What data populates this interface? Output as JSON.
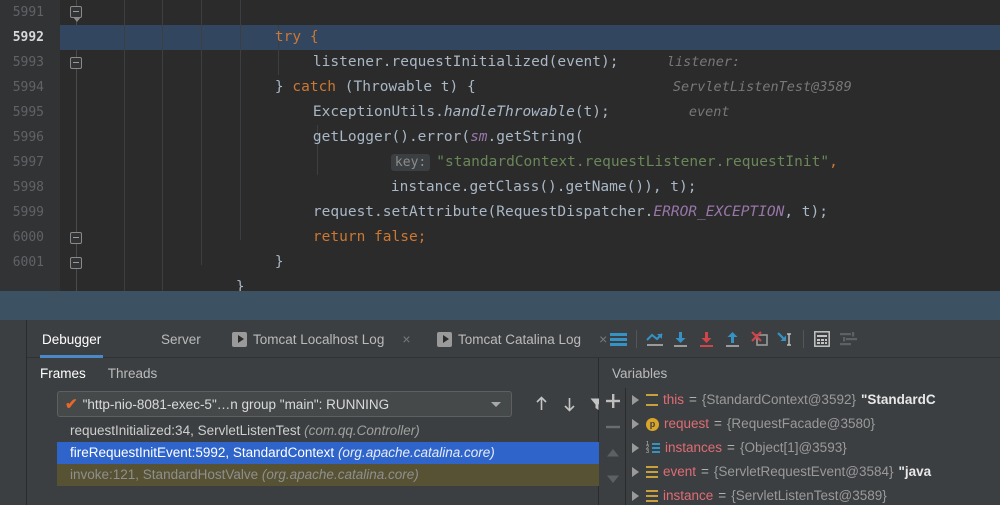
{
  "editor": {
    "first_line": 5991,
    "current_line": 5992,
    "lines": [
      {
        "num": "5991",
        "fold": "arrow"
      },
      {
        "num": "5992",
        "fold": ""
      },
      {
        "num": "5993",
        "fold": "plain"
      },
      {
        "num": "5994",
        "fold": ""
      },
      {
        "num": "5995",
        "fold": ""
      },
      {
        "num": "5996",
        "fold": ""
      },
      {
        "num": "5997",
        "fold": ""
      },
      {
        "num": "5998",
        "fold": ""
      },
      {
        "num": "5999",
        "fold": ""
      },
      {
        "num": "6000",
        "fold": "plain"
      },
      {
        "num": "6001",
        "fold": "plain"
      }
    ],
    "code": {
      "l5991": "try {",
      "l5992_code": "listener.requestInitialized(event);",
      "l5992_hint_listener": "listener:",
      "l5992_hint_listener_val": "ServletListenTest@3589",
      "l5992_hint_event": "event",
      "l5993_a": "} ",
      "l5993_b": "catch ",
      "l5993_c": "(Throwable t) {",
      "l5994_a": "ExceptionUtils.",
      "l5994_b": "handleThrowable",
      "l5994_c": "(t);",
      "l5995_a": "getLogger().error(",
      "l5995_b": "sm",
      "l5995_c": ".getString(",
      "l5996_key": "key:",
      "l5996_str": "\"standardContext.requestListener.requestInit\"",
      "l5996_comma": ",",
      "l5997": "instance.getClass().getName()), t);",
      "l5998_a": "request.setAttribute(RequestDispatcher.",
      "l5998_b": "ERROR_EXCEPTION",
      "l5998_c": ", t);",
      "l5999_a": "return ",
      "l5999_b": "false;",
      "l6000": "}",
      "l6001": "}"
    },
    "colors": {
      "background": "#2b2b2b",
      "gutter": "#313335",
      "selected_line": "#32465f",
      "keyword": "#cc7832",
      "string": "#6a8759",
      "field": "#9876aa",
      "text": "#a9b7c6",
      "hint": "#787878"
    }
  },
  "toolwindow": {
    "tabs": [
      {
        "label": "Debugger",
        "active": true,
        "icon": "",
        "close": false
      },
      {
        "label": "Server",
        "active": false,
        "icon": "",
        "close": false
      },
      {
        "label": "Tomcat Localhost Log",
        "active": false,
        "icon": "run-icon",
        "close": true
      },
      {
        "label": "Tomcat Catalina Log",
        "active": false,
        "icon": "run-icon",
        "close": true
      }
    ],
    "toolbar_icons": [
      "mute-breakpoints-icon",
      "show-execution-point-icon",
      "step-over-icon",
      "step-into-icon",
      "step-out-icon",
      "force-step-into-icon",
      "run-to-cursor-icon",
      "evaluate-expression-icon",
      "settings-icon"
    ],
    "close_label": "×"
  },
  "frames": {
    "subtabs": [
      {
        "label": "Frames",
        "active": true
      },
      {
        "label": "Threads",
        "active": false
      }
    ],
    "thread_selector": {
      "check": "✔",
      "value": "\"http-nio-8081-exec-5\"…n group \"main\": RUNNING"
    },
    "buttons": [
      "move-up-icon",
      "move-down-icon",
      "filter-icon"
    ],
    "rows": [
      {
        "main": "requestInitialized:34, ServletListenTest",
        "pkg": "(com.qq.Controller)",
        "state": ""
      },
      {
        "main": "fireRequestInitEvent:5992, StandardContext",
        "pkg": "(org.apache.catalina.core)",
        "state": "sel"
      },
      {
        "main": "invoke:121, StandardHostValve",
        "pkg": "(org.apache.catalina.core)",
        "state": "dim"
      }
    ]
  },
  "variables": {
    "title": "Variables",
    "strip_buttons": [
      "add-watch-icon",
      "remove-watch-icon",
      "scroll-up-icon",
      "scroll-down-icon"
    ],
    "rows": [
      {
        "icon": "object-icon",
        "name": "this",
        "eq": " = ",
        "value": "{StandardContext@3592} ",
        "str": "\"StandardC"
      },
      {
        "icon": "param-icon",
        "name": "request",
        "eq": " = ",
        "value": "{RequestFacade@3580}",
        "str": ""
      },
      {
        "icon": "array-icon",
        "name": "instances",
        "eq": " = ",
        "value": "{Object[1]@3593}",
        "str": ""
      },
      {
        "icon": "object-icon",
        "name": "event",
        "eq": " = ",
        "value": "{ServletRequestEvent@3584} ",
        "str": "\"java"
      },
      {
        "icon": "object-icon",
        "name": "instance",
        "eq": " = ",
        "value": "{ServletListenTest@3589}",
        "str": ""
      }
    ]
  },
  "accents": {
    "tab_underline": "#4a88c7",
    "selection_blue": "#2f65ca",
    "band": "#3c5161",
    "red": "#d0444a",
    "blue": "#3592c4",
    "orange": "#e8672a",
    "yellow": "#c8a03c"
  }
}
